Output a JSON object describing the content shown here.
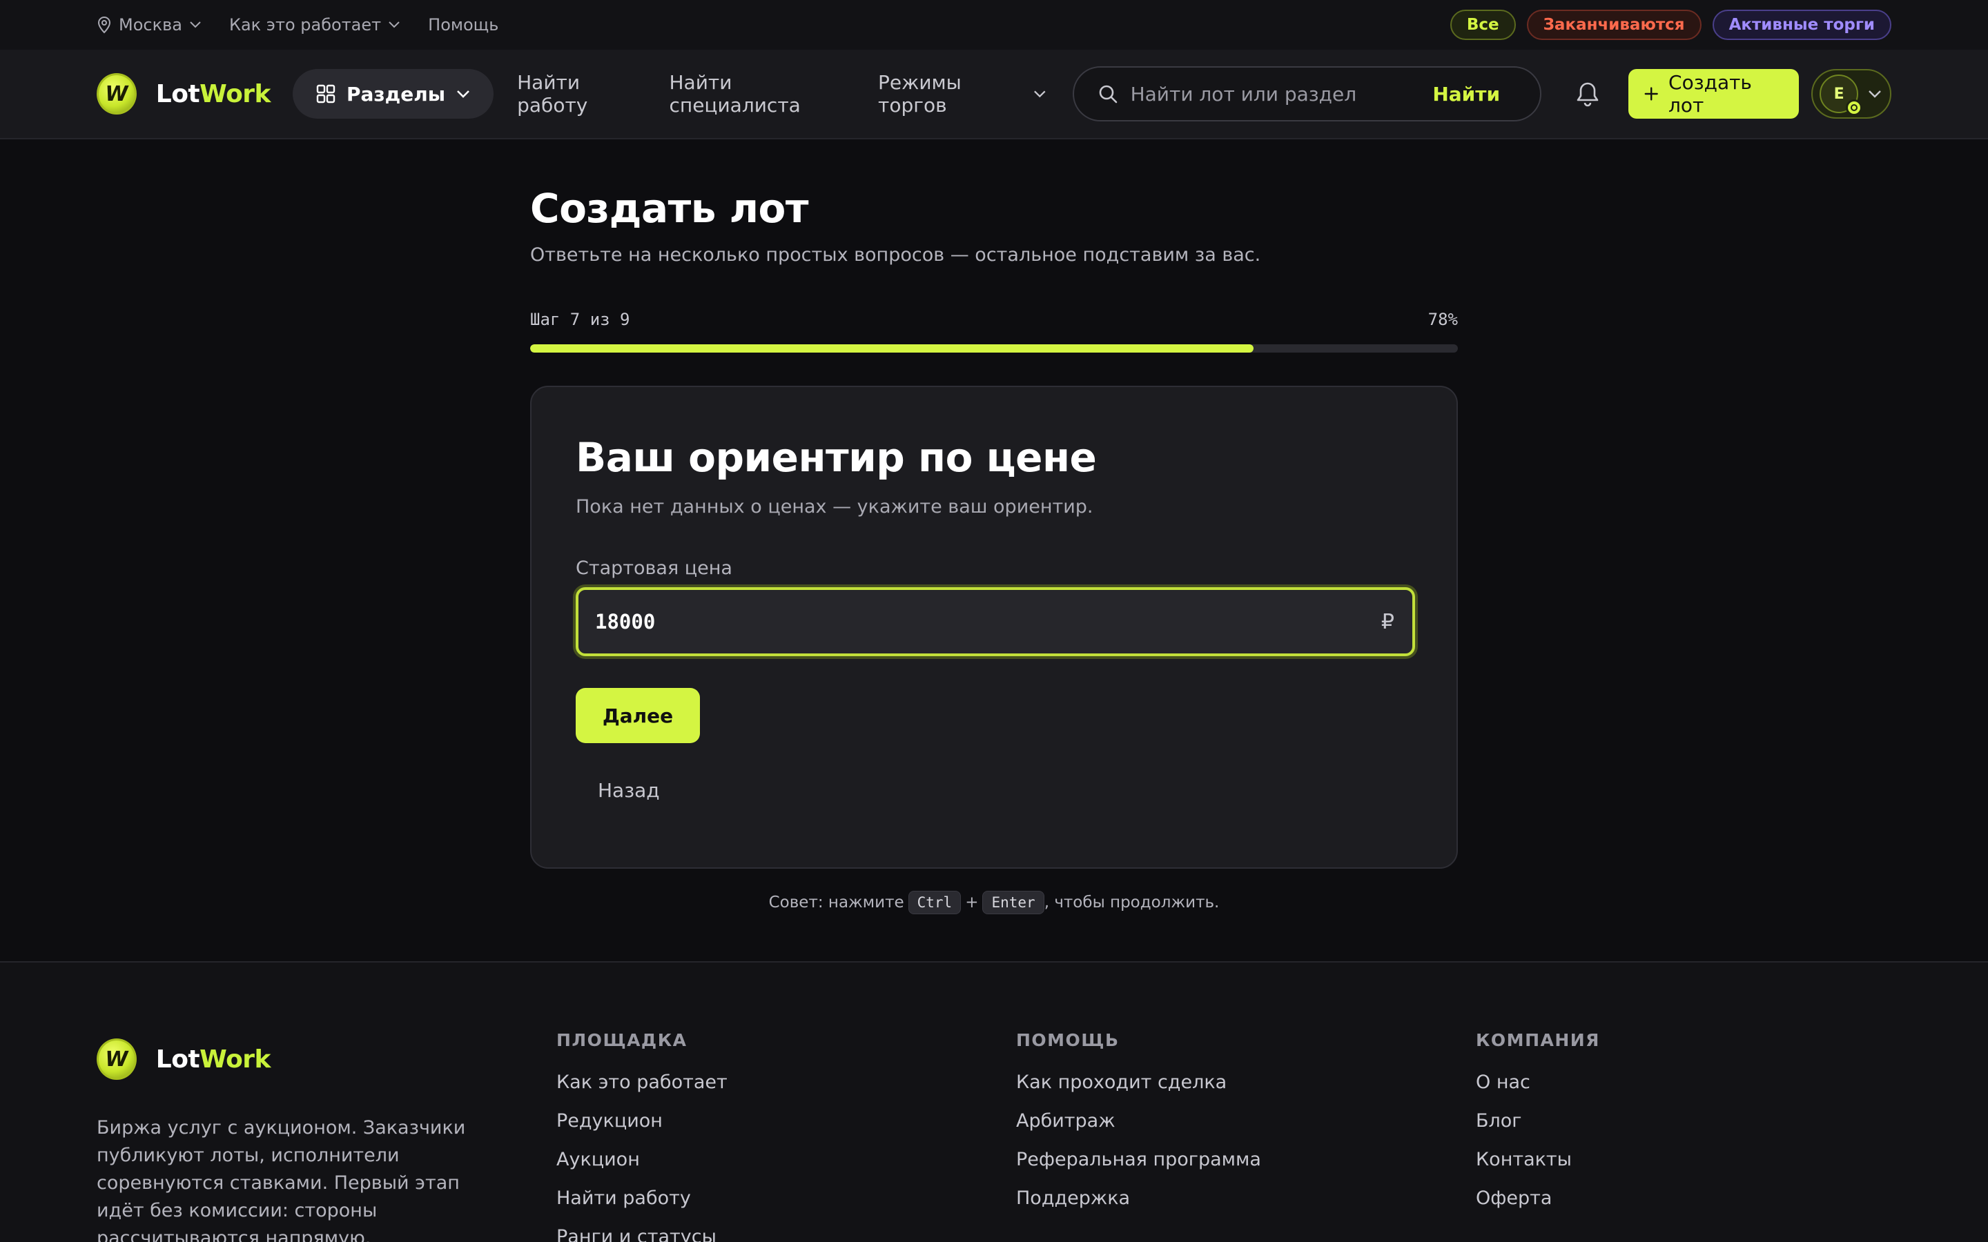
{
  "topbar": {
    "city": "Москва",
    "how_it_works": "Как это работает",
    "help": "Помощь",
    "filters": {
      "all": "Все",
      "ending": "Заканчиваются",
      "active": "Активные торги"
    }
  },
  "header": {
    "logo": {
      "lot": "Lot",
      "work": "Work",
      "mark": "W"
    },
    "sections_label": "Разделы",
    "nav": {
      "find_work": "Найти работу",
      "find_specialist": "Найти специалиста",
      "trade_modes": "Режимы торгов"
    },
    "search": {
      "placeholder": "Найти лот или раздел",
      "button": "Найти"
    },
    "create_lot": "Создать лот",
    "user_initial": "E"
  },
  "main": {
    "title": "Создать лот",
    "subtitle": "Ответьте на несколько простых вопросов — остальное подставим за вас.",
    "step_label": "Шаг 7 из 9",
    "progress_label": "78%",
    "progress": 0.78,
    "card": {
      "title": "Ваш ориентир по цене",
      "subtitle": "Пока нет данных о ценах — укажите ваш ориентир.",
      "price_label": "Стартовая цена",
      "price_value": "18000",
      "currency": "₽",
      "next": "Далее",
      "back": "Назад"
    },
    "tip": {
      "prefix": "Совет: нажмите",
      "key1": "Ctrl",
      "plus": "+",
      "key2": "Enter",
      "suffix": ", чтобы продолжить."
    }
  },
  "footer": {
    "description": "Биржа услуг с аукционом. Заказчики публикуют лоты, исполнители соревнуются ставками. Первый этап идёт без комиссии: стороны рассчитываются напрямую.",
    "columns": [
      {
        "title": "ПЛОЩАДКА",
        "links": [
          "Как это работает",
          "Редукцион",
          "Аукцион",
          "Найти работу",
          "Ранги и статусы"
        ]
      },
      {
        "title": "ПОМОЩЬ",
        "links": [
          "Как проходит сделка",
          "Арбитраж",
          "Реферальная программа",
          "Поддержка"
        ]
      },
      {
        "title": "КОМПАНИЯ",
        "links": [
          "О нас",
          "Блог",
          "Контакты",
          "Оферта"
        ]
      }
    ]
  },
  "colors": {
    "accent": "#d4f542",
    "ending": "#ff6a4d",
    "active": "#a08cff",
    "background": "#0d0d10"
  }
}
